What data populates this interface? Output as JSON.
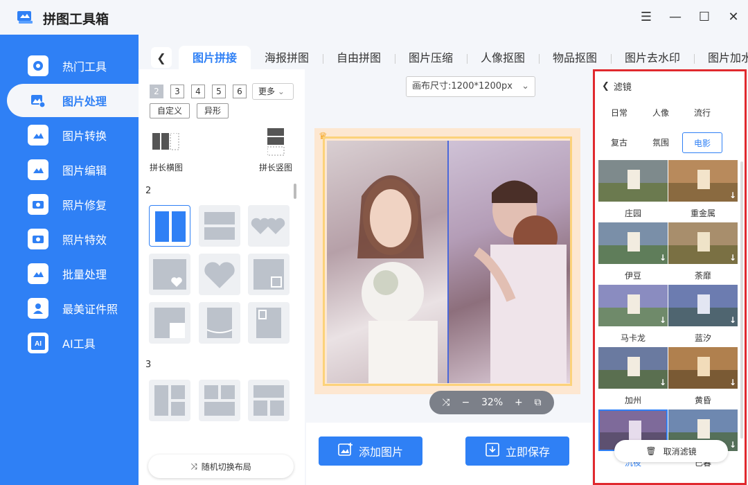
{
  "app": {
    "title": "拼图工具箱"
  },
  "sidebar": {
    "items": [
      {
        "label": "热门工具",
        "icon": "gear-icon"
      },
      {
        "label": "图片处理",
        "icon": "image-process-icon",
        "active": true
      },
      {
        "label": "图片转换",
        "icon": "image-convert-icon"
      },
      {
        "label": "图片编辑",
        "icon": "image-edit-icon"
      },
      {
        "label": "照片修复",
        "icon": "photo-repair-icon"
      },
      {
        "label": "照片特效",
        "icon": "photo-effect-icon"
      },
      {
        "label": "批量处理",
        "icon": "batch-icon"
      },
      {
        "label": "最美证件照",
        "icon": "id-photo-icon"
      },
      {
        "label": "AI工具",
        "icon": "ai-icon"
      }
    ]
  },
  "tabs": [
    "图片拼接",
    "海报拼图",
    "自由拼图",
    "图片压缩",
    "人像抠图",
    "物品抠图",
    "图片去水印",
    "图片加水"
  ],
  "layout": {
    "counts": [
      "2",
      "3",
      "4",
      "5",
      "6"
    ],
    "more": "更多",
    "custom": "自定义",
    "irregular": "异形",
    "long_horizontal": "拼长横图",
    "long_vertical": "拼长竖图",
    "section2": "2",
    "section3": "3",
    "random": "随机切换布局"
  },
  "canvas": {
    "size_label": "画布尺寸:1200*1200px",
    "zoom": "32%"
  },
  "actions": {
    "add": "添加图片",
    "save": "立即保存"
  },
  "filters": {
    "title": "滤镜",
    "categories": [
      "日常",
      "人像",
      "流行",
      "复古",
      "氛围",
      "电影"
    ],
    "active_category": "电影",
    "items": [
      "庄园",
      "重金属",
      "伊豆",
      "荼靡",
      "马卡龙",
      "蓝汐",
      "加州",
      "黄昏",
      "沉夜",
      "已暮"
    ],
    "cancel": "取消滤镜"
  },
  "colors": {
    "accent": "#2f80f5",
    "highlight": "#e0292e"
  }
}
